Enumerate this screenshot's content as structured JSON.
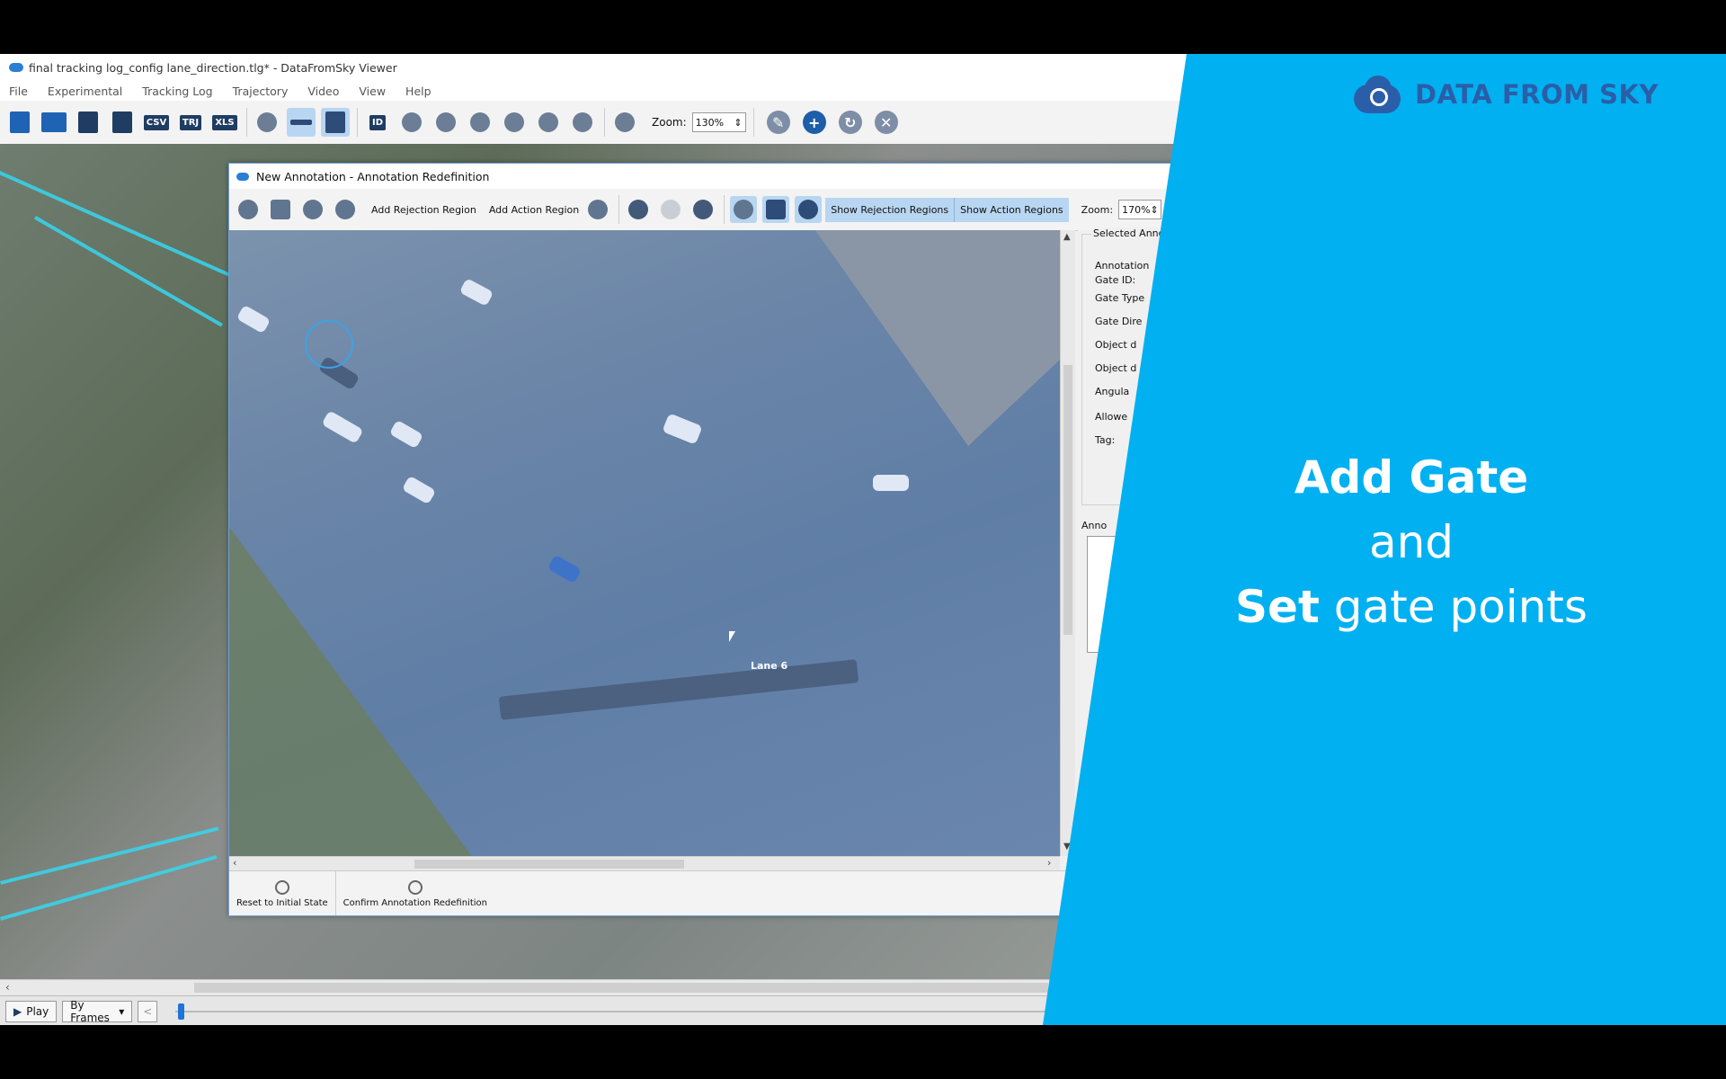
{
  "window": {
    "title": "final tracking log_config lane_direction.tlg* - DataFromSky Viewer",
    "menu": [
      "File",
      "Experimental",
      "Tracking Log",
      "Trajectory",
      "Video",
      "View",
      "Help"
    ],
    "toolbar": {
      "labels": {
        "csv": "CSV",
        "trj": "TRJ",
        "xls": "XLS",
        "id": "ID"
      },
      "zoom_label": "Zoom:",
      "zoom_value": "130%"
    },
    "playback": {
      "play_label": "Play",
      "mode_value": "By Frames",
      "prev_label": "<"
    }
  },
  "dialog": {
    "title": "New Annotation - Annotation Redefinition",
    "toolbar": {
      "add_rejection_region": "Add Rejection Region",
      "add_action_region": "Add Action Region",
      "show_rejection_regions": "Show Rejection Regions",
      "show_action_regions": "Show Action Regions",
      "zoom_label": "Zoom:",
      "zoom_value": "170%"
    },
    "canvas": {
      "lane_label": "Lane 6"
    },
    "bottom": {
      "reset": "Reset to Initial State",
      "confirm": "Confirm Annotation Redefinition"
    },
    "side_panel": {
      "group_title": "Selected Annot",
      "fields": [
        "Annotation",
        "Gate ID:",
        "Gate Type",
        "Gate Dire",
        "Object d",
        "Object d",
        "Angula",
        "Allowe",
        "Tag:"
      ],
      "group2_title": "Anno"
    }
  },
  "promo": {
    "logo_text": "DATA FROM SKY",
    "headline": {
      "line1": "Add Gate",
      "line2": "and",
      "line3_bold": "Set",
      "line3_rest": " gate points"
    },
    "colors": {
      "panel": "#01b0f1",
      "logo": "#2b5ea8"
    }
  }
}
